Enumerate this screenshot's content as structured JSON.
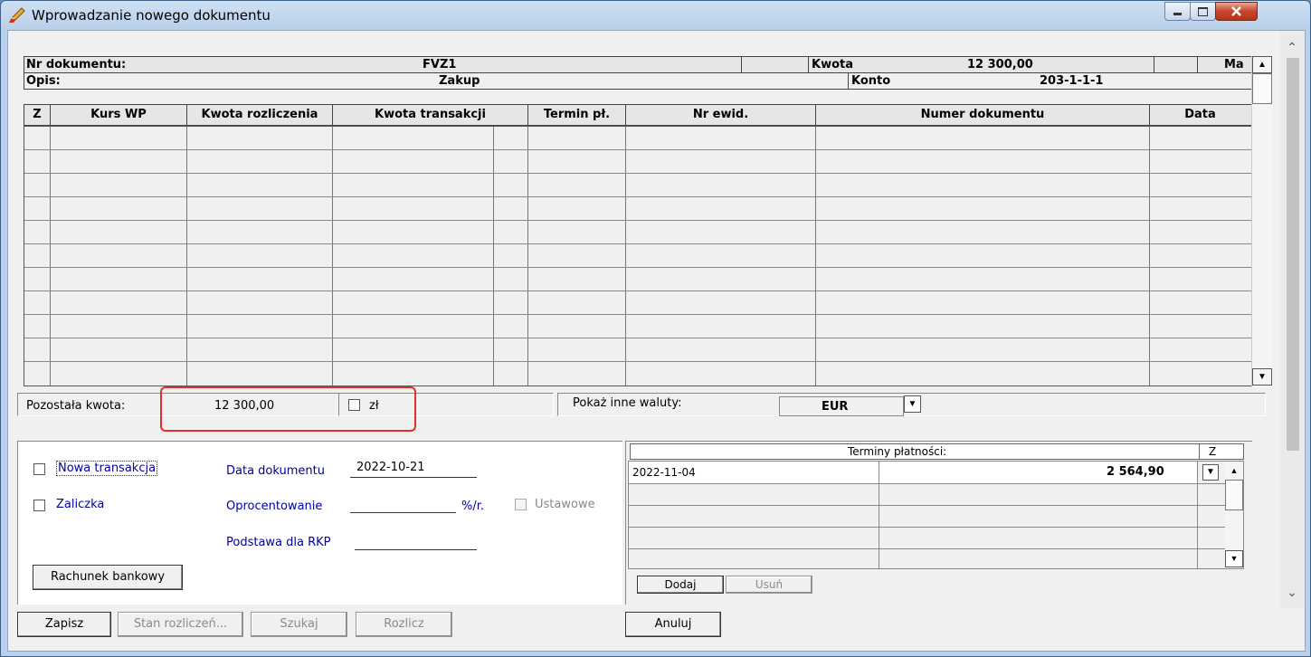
{
  "window": {
    "title": "Wprowadzanie nowego dokumentu"
  },
  "header": {
    "nr_label": "Nr dokumentu:",
    "nr_value": "FVZ1",
    "kwota_label": "Kwota",
    "kwota_value": "12 300,00",
    "ma_label": "Ma",
    "opis_label": "Opis:",
    "opis_value": "Zakup",
    "konto_label": "Konto",
    "konto_value": "203-1-1-1"
  },
  "grid": {
    "columns": [
      "Z",
      "Kurs WP",
      "Kwota rozliczenia",
      "Kwota transakcji",
      "Termin pł.",
      "Nr ewid.",
      "Numer dokumentu",
      "Data"
    ],
    "rows": []
  },
  "status": {
    "pozostala_label": "Pozostała kwota:",
    "pozostala_value": "12 300,00",
    "zl_label": "zł",
    "waluty_label": "Pokaż inne waluty:",
    "currency": "EUR"
  },
  "form": {
    "nowa_transakcja": "Nowa transakcja",
    "zaliczka": "Zaliczka",
    "data_label": "Data dokumentu",
    "data_value": "2022-10-21",
    "oprocentowanie_label": "Oprocentowanie",
    "oprocentowanie_unit": "%/r.",
    "ustawowe": "Ustawowe",
    "podstawa_label": "Podstawa dla RKP",
    "rachunek_button": "Rachunek bankowy"
  },
  "terminy": {
    "header": "Terminy płatności:",
    "z_header": "Z",
    "rows": [
      {
        "date": "2022-11-04",
        "amount": "2 564,90"
      }
    ],
    "dodaj": "Dodaj",
    "usun": "Usuń"
  },
  "buttons": {
    "zapisz": "Zapisz",
    "stan": "Stan rozliczeń...",
    "szukaj": "Szukaj",
    "rozlicz": "Rozlicz",
    "anuluj": "Anuluj"
  },
  "colors": {
    "highlight": "#e0302a",
    "link": "#0000a0"
  }
}
